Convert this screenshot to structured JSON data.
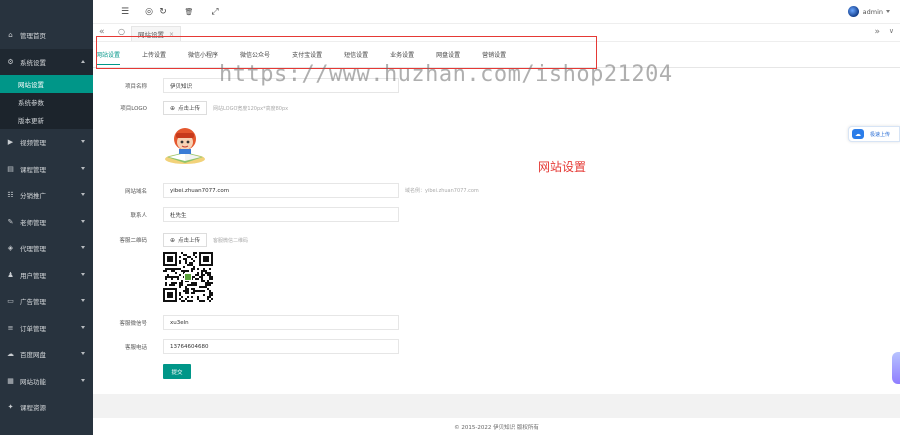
{
  "sidebar": {
    "items": [
      {
        "icon": "home-icon",
        "label": "管理首页",
        "has_children": false
      },
      {
        "icon": "gear-icon",
        "label": "系统设置",
        "has_children": true,
        "open": true,
        "children": [
          {
            "label": "网站设置",
            "active": true
          },
          {
            "label": "系统参数",
            "active": false
          },
          {
            "label": "版本更新",
            "active": false
          }
        ]
      },
      {
        "icon": "video-icon",
        "label": "视频管理",
        "has_children": true
      },
      {
        "icon": "course-icon",
        "label": "课程管理",
        "has_children": true
      },
      {
        "icon": "promo-icon",
        "label": "分销推广",
        "has_children": true
      },
      {
        "icon": "teacher-icon",
        "label": "老师管理",
        "has_children": true
      },
      {
        "icon": "agent-icon",
        "label": "代理管理",
        "has_children": true
      },
      {
        "icon": "user-icon",
        "label": "用户管理",
        "has_children": true
      },
      {
        "icon": "ad-icon",
        "label": "广告管理",
        "has_children": true
      },
      {
        "icon": "order-icon",
        "label": "订单管理",
        "has_children": true
      },
      {
        "icon": "cloud-disk-icon",
        "label": "百度网盘",
        "has_children": true
      },
      {
        "icon": "grid-icon",
        "label": "网站功能",
        "has_children": true
      },
      {
        "icon": "class-icon",
        "label": "课程资源",
        "has_children": false
      }
    ]
  },
  "topbar": {
    "tools": [
      {
        "name": "menu-toggle-icon",
        "glyph": "☰"
      },
      {
        "name": "globe-icon",
        "glyph": "◎"
      },
      {
        "name": "refresh-icon",
        "glyph": "↻"
      },
      {
        "name": "trash-icon",
        "glyph": "🗑"
      },
      {
        "name": "fullscreen-icon",
        "glyph": "⤢"
      }
    ],
    "user": "admin"
  },
  "tabbar": {
    "prev": "«",
    "home": "○",
    "tab_label": "网站设置",
    "tab_close": "×",
    "next": "»",
    "more": "∨"
  },
  "settings_tabs": [
    "网站设置",
    "上传设置",
    "微信小程序",
    "微信公众号",
    "支付宝设置",
    "短信设置",
    "业务设置",
    "网盘设置",
    "营销设置"
  ],
  "form": {
    "site_name": {
      "label": "项目名称",
      "value": "伊贝知识"
    },
    "site_logo": {
      "label": "项目LOGO",
      "button": "点击上传",
      "hint": "网站LOGO宽度120px*高度80px"
    },
    "domain": {
      "label": "网站域名",
      "value": "yibei.zhuan7077.com",
      "hint": "域名例：yibei.zhuan7077.com"
    },
    "contact": {
      "label": "联系人",
      "value": "杜先生"
    },
    "qrcode": {
      "label": "客服二维码",
      "button": "点击上传",
      "hint": "客服微信二维码"
    },
    "wechat": {
      "label": "客服微信号",
      "value": "xu3eln"
    },
    "phone": {
      "label": "客服电话",
      "value": "13764604680"
    },
    "submit": "提交"
  },
  "watermark": "https://www.huzhan.com/ishop21204",
  "annotation": "网站设置",
  "float_button": "极速上传",
  "footer": "© 2015-2022 伊贝知识 版权所有",
  "colors": {
    "accent": "#009688",
    "sidebar": "#28333e",
    "annotation": "#e53935"
  }
}
